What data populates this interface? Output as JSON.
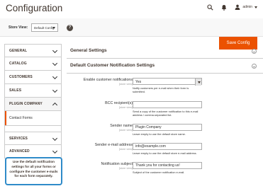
{
  "header": {
    "title": "Configuration",
    "user_name": "admin"
  },
  "scope": {
    "label": "Store View:",
    "value": "Default Config",
    "help": "?"
  },
  "actions": {
    "save_label": "Save Config"
  },
  "sidebar": {
    "items": [
      {
        "label": "GENERAL"
      },
      {
        "label": "CATALOG"
      },
      {
        "label": "CUSTOMERS"
      },
      {
        "label": "SALES"
      },
      {
        "label": "PLUGIN COMPANY"
      },
      {
        "label": "Contact Forms"
      },
      {
        "label": "SERVICES"
      },
      {
        "label": "ADVANCED"
      }
    ]
  },
  "tooltip": {
    "text": "Use the default notification settings for all your forms or configure the customer e-mails for each form separately."
  },
  "sections": {
    "general": "General Settings",
    "default_notification": "Default Customer Notification Settings"
  },
  "form": {
    "enable": {
      "label": "Enable customer notifications",
      "scope": "[store view]",
      "value": "Yes",
      "note": "Notify customers per e-mail when their form is submitted."
    },
    "bcc": {
      "label": "BCC recipient(s)",
      "scope": "[store view]",
      "value": "",
      "note": "Send a copy of the customer notification to this e-mail address / comma-separated list."
    },
    "sender_name": {
      "label": "Sender name",
      "scope": "[store view]",
      "value": "Plugin Company",
      "note": "Leave empty to use the default store name."
    },
    "sender_email": {
      "label": "Sender e-mail address",
      "scope": "[store view]",
      "value": "info@example.com",
      "note": "Leave empty to use the default store e-mail address."
    },
    "subject": {
      "label": "Notification subject",
      "scope": "[store view]",
      "value": "Thank you for contacting us!",
      "note": "Subject of the customer notification e-mail."
    }
  },
  "colors": {
    "accent": "#eb5202",
    "tooltip_border": "#2f8bc9"
  }
}
